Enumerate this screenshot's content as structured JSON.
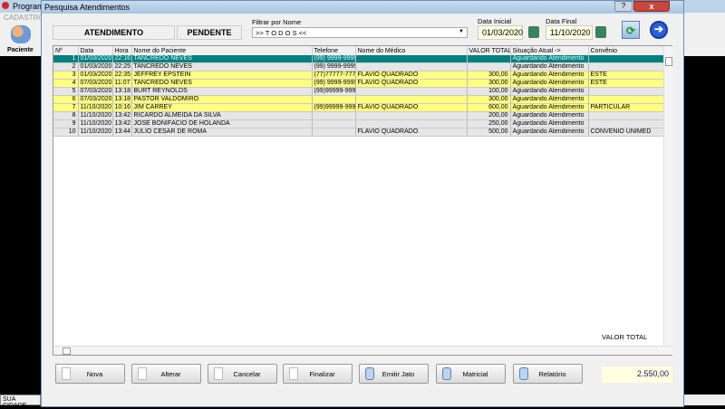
{
  "app": {
    "title": "Programa",
    "menu": "CADASTROS",
    "toolbar_paciente": "Paciente",
    "status_city": "SUA CIDADE"
  },
  "dialog": {
    "title": "Pesquisa Atendimentos",
    "help": "?",
    "close": "x"
  },
  "header": {
    "atendimento": "ATENDIMENTO",
    "pendente": "PENDENTE",
    "filter_label": "Filtrar por Nome",
    "filter_value": ">> T O D O S <<",
    "data_inicial_label": "Data Inicial",
    "data_inicial": "01/03/2020",
    "data_final_label": "Data Final",
    "data_final": "11/10/2020"
  },
  "grid": {
    "columns": [
      "Nº",
      "Data",
      "Hora",
      "Nome do Paciente",
      "Telefone",
      "Nome do Médico",
      "VALOR TOTAL",
      "Situação Atual ->",
      "Convênio"
    ],
    "rows": [
      {
        "n": "1",
        "data": "01/03/2020",
        "hora": "22:16",
        "nome": "TANCREDO NEVES",
        "tel": "(99) 9999-9999",
        "medico": "",
        "valor": "",
        "sit": "Aguardando Atendimento",
        "conv": "",
        "style": "s"
      },
      {
        "n": "2",
        "data": "01/03/2020",
        "hora": "22:25",
        "nome": "TANCREDO NEVES",
        "tel": "(99) 9999-9999",
        "medico": "",
        "valor": "",
        "sit": "Aguardando Atendimento",
        "conv": "",
        "style": "g"
      },
      {
        "n": "3",
        "data": "01/03/2020",
        "hora": "22:35",
        "nome": "JEFFREY EPSTEIN",
        "tel": "(77)77777-7777",
        "medico": "FLAVIO QUADRADO",
        "valor": "300,00",
        "sit": "Aguardando Atendimento",
        "conv": "ESTE",
        "style": "y"
      },
      {
        "n": "4",
        "data": "07/03/2020",
        "hora": "11:07",
        "nome": "TANCREDO NEVES",
        "tel": "(99) 9999-9999",
        "medico": "FLAVIO QUADRADO",
        "valor": "300,00",
        "sit": "Aguardando Atendimento",
        "conv": "ESTE",
        "style": "y"
      },
      {
        "n": "5",
        "data": "07/03/2020",
        "hora": "13:18",
        "nome": "BURT REYNOLDS",
        "tel": "(99)99999-9999",
        "medico": "",
        "valor": "100,00",
        "sit": "Aguardando Atendimento",
        "conv": "",
        "style": "g"
      },
      {
        "n": "6",
        "data": "07/03/2020",
        "hora": "13:18",
        "nome": "PASTOR VALDOMIRO",
        "tel": "",
        "medico": "",
        "valor": "300,00",
        "sit": "Aguardando Atendimento",
        "conv": "",
        "style": "y"
      },
      {
        "n": "7",
        "data": "11/10/2020",
        "hora": "10:16",
        "nome": "JIM CARREY",
        "tel": "(99)99999-9999",
        "medico": "FLAVIO QUADRADO",
        "valor": "600,00",
        "sit": "Aguardando Atendimento",
        "conv": "PARTICULAR",
        "style": "y"
      },
      {
        "n": "8",
        "data": "11/10/2020",
        "hora": "13:42",
        "nome": "RICARDO ALMEIDA DA SILVA",
        "tel": "",
        "medico": "",
        "valor": "200,00",
        "sit": "Aguardando Atendimento",
        "conv": "",
        "style": "g"
      },
      {
        "n": "9",
        "data": "11/10/2020",
        "hora": "13:42",
        "nome": "JOSÉ BONIFÁCIO DE HOLANDA",
        "tel": "",
        "medico": "",
        "valor": "250,00",
        "sit": "Aguardando Atendimento",
        "conv": "",
        "style": "g"
      },
      {
        "n": "10",
        "data": "11/10/2020",
        "hora": "13:44",
        "nome": "JULIO CESAR DE ROMA",
        "tel": "",
        "medico": "FLAVIO QUADRADO",
        "valor": "500,00",
        "sit": "Aguardando Atendimento",
        "conv": "CONVENIO UNIMED",
        "style": "g"
      }
    ]
  },
  "buttons": {
    "nova": "Nova",
    "alterar": "Alterar",
    "cancelar": "Cancelar",
    "finalizar": "Finalizar",
    "emitir_jato": "Emitir Jato",
    "matricial": "Matricial",
    "relatorio": "Relatório"
  },
  "total": {
    "label": "VALOR TOTAL",
    "value": "2.550,00"
  }
}
